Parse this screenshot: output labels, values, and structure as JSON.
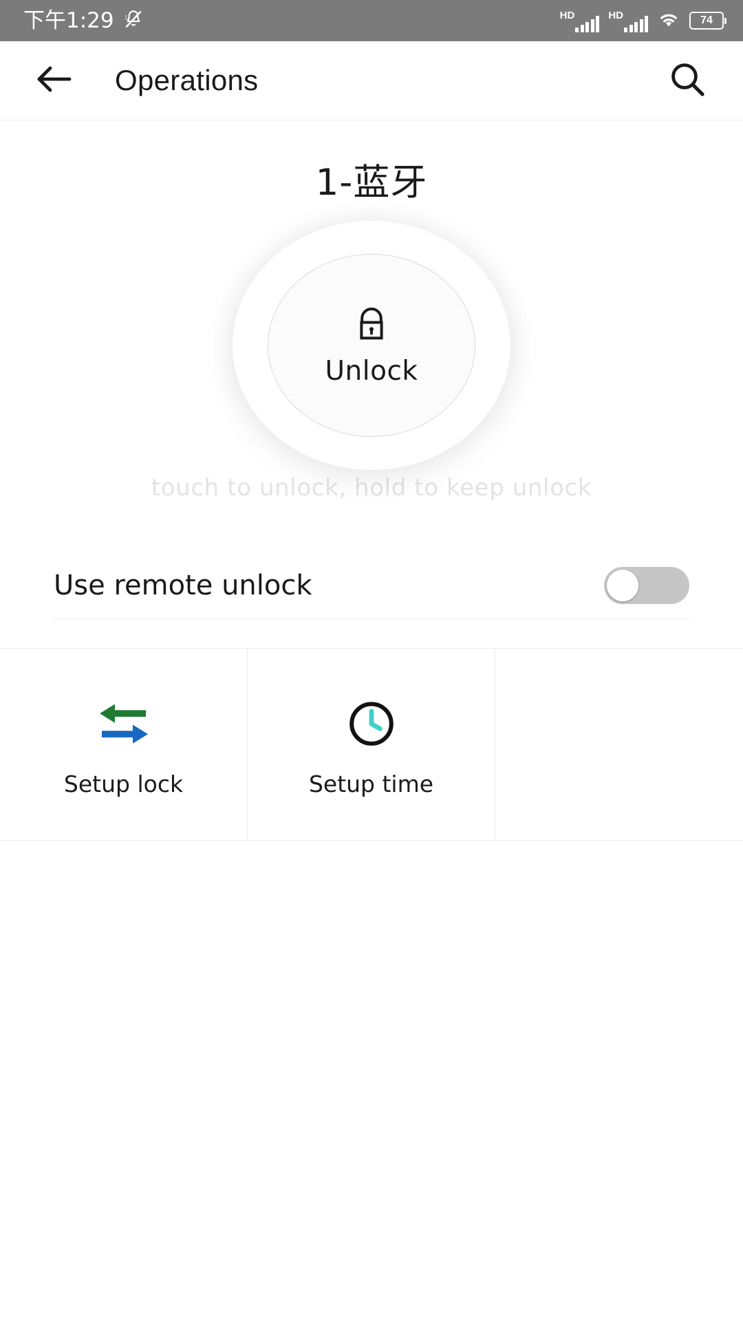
{
  "status_bar": {
    "time": "下午1:29",
    "mute_icon": "bell-muted-icon",
    "sim1": {
      "hd_label": "HD",
      "icon": "signal-bars-icon"
    },
    "sim2": {
      "hd_label": "HD",
      "icon": "signal-bars-icon"
    },
    "wifi_icon": "wifi-icon",
    "battery_level": "74",
    "background_color": "#7b7b7b"
  },
  "app_bar": {
    "back_icon": "back-arrow-icon",
    "title": "Operations",
    "search_icon": "search-icon"
  },
  "main": {
    "device_name": "1-蓝牙",
    "unlock_button": {
      "icon": "padlock-closed-icon",
      "label": "Unlock"
    },
    "hint": "touch to unlock, hold to keep unlock",
    "remote_unlock": {
      "label": "Use remote unlock",
      "enabled": "false"
    },
    "actions": [
      {
        "icon": "sync-arrows-icon",
        "label": "Setup lock"
      },
      {
        "icon": "clock-icon",
        "label": "Setup time"
      },
      {
        "icon": "",
        "label": ""
      }
    ]
  },
  "colors": {
    "status_bar_bg": "#7b7b7b",
    "text_primary": "#1a1a1a",
    "hint_gray": "#e3e3e3",
    "switch_track_off": "#c6c6c6",
    "arrow_green": "#1f7a33",
    "arrow_blue": "#1668c1",
    "clock_teal": "#3fd0c9"
  }
}
